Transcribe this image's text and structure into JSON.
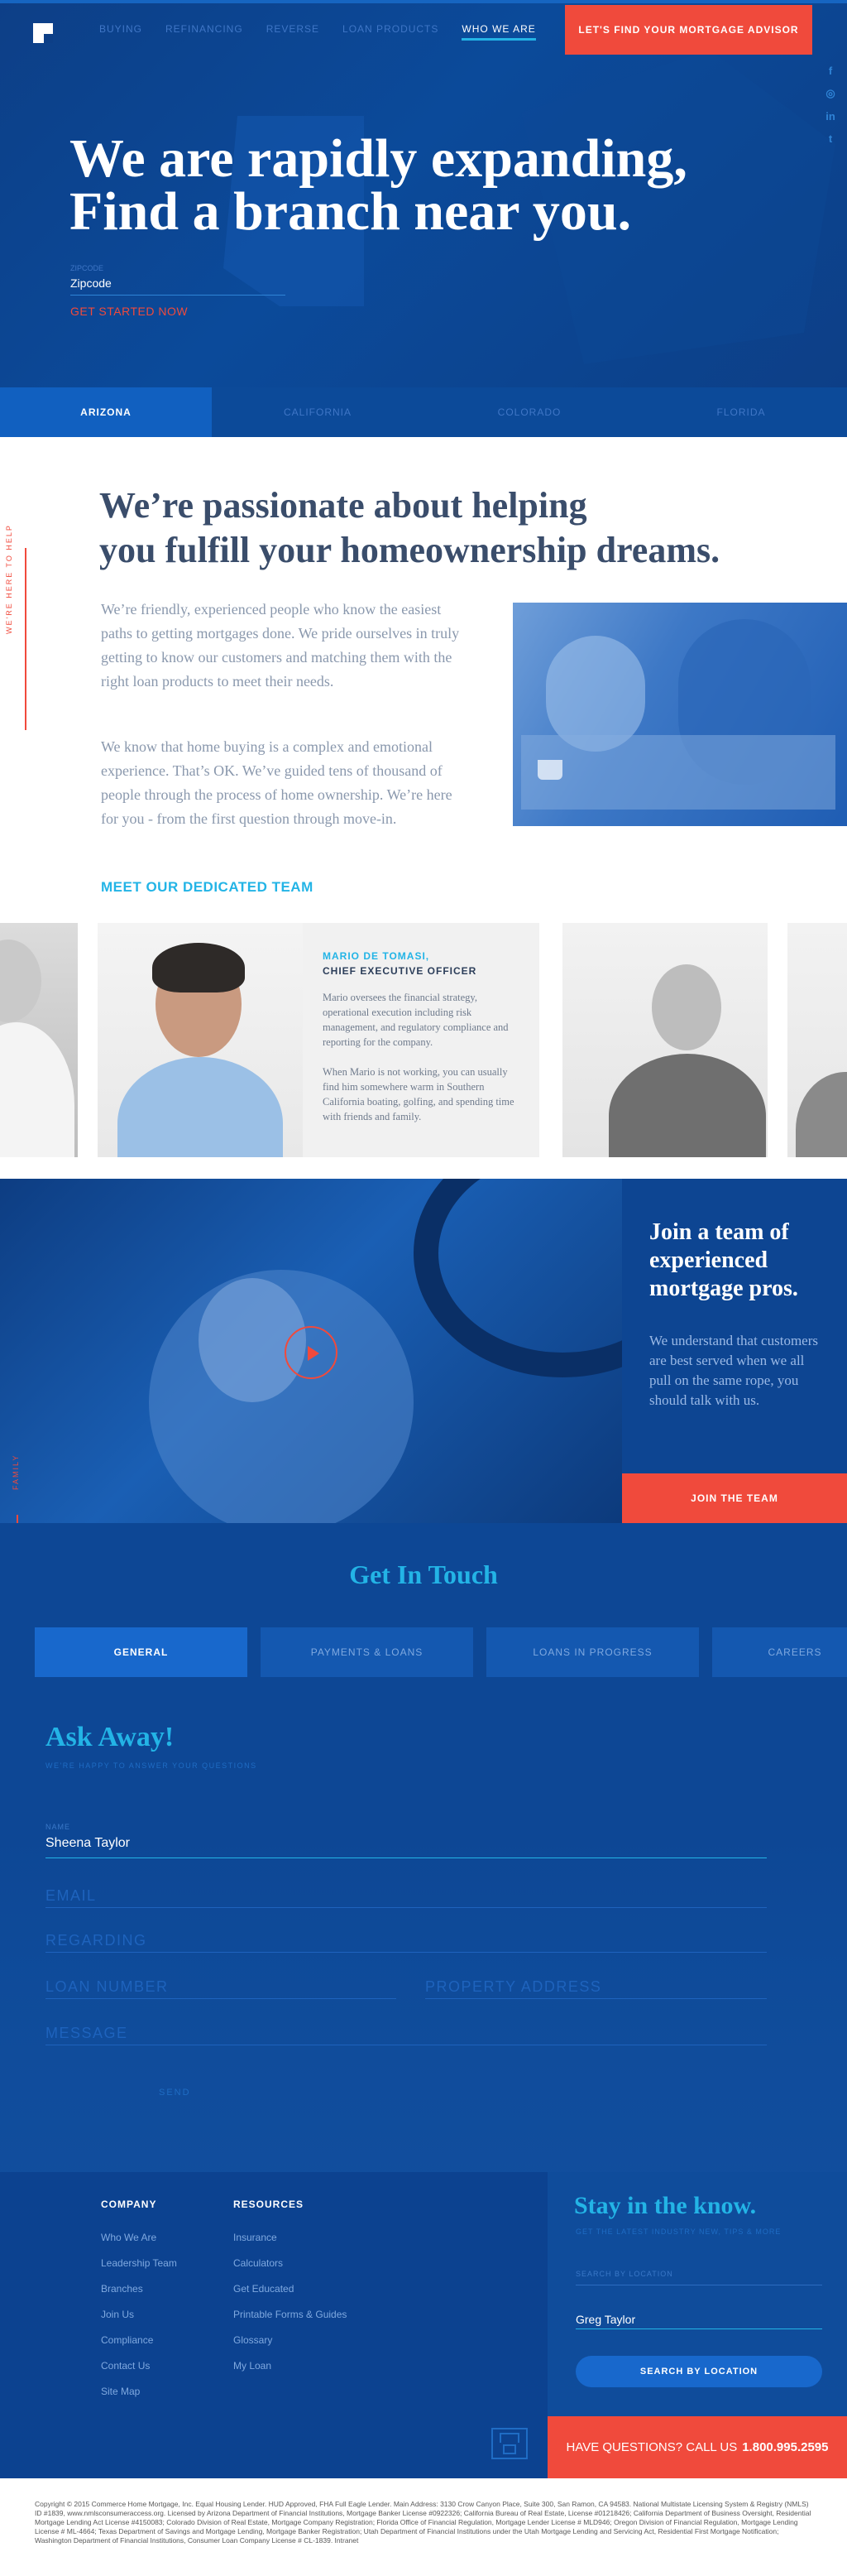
{
  "nav": {
    "items": [
      "BUYING",
      "REFINANCING",
      "REVERSE",
      "LOAN PRODUCTS",
      "WHO WE ARE"
    ],
    "active": "WHO WE ARE",
    "cta": "LET'S FIND YOUR MORTGAGE ADVISOR",
    "social": [
      "f",
      "◎",
      "in",
      "t"
    ]
  },
  "hero": {
    "title_line1": "We are rapidly expanding,",
    "title_line2": "Find a branch near you.",
    "zip_label": "Zipcode",
    "zip_value": "Zipcode",
    "get_started": "GET STARTED NOW"
  },
  "states": [
    "ARIZONA",
    "CALIFORNIA",
    "COLORADO",
    "FLORIDA"
  ],
  "passion": {
    "side_label": "WE'RE HERE TO HELP",
    "title_line1": "We’re  passionate about helping",
    "title_line2": "you fulfill your homeownership dreams.",
    "p1": "We’re friendly, experienced people who know the easiest paths to getting mortgages done. We pride ourselves in truly getting to know our customers and matching them with the right loan products to meet their needs.",
    "p2": "We know that home buying is a complex and emotional experience. That’s OK. We’ve guided tens of thousand of people through the process of home ownership. We’re here for you - from the first question through move-in.",
    "team_link": "MEET OUR DEDICATED TEAM"
  },
  "team": {
    "name": "MARIO DE TOMASI,",
    "role": "CHIEF EXECUTIVE OFFICER",
    "bio1": "Mario oversees the financial strategy, operational execution including risk management, and regulatory compliance and reporting for the company.",
    "bio2": "When Mario is not working, you can usually find him somewhere warm in Southern California boating, golfing, and spending time with friends and family."
  },
  "join": {
    "title": "Join a team of experienced mortgage pros.",
    "text": "We understand that customers are best served when we all pull on the same rope, you should talk with us.",
    "button": "JOIN THE TEAM",
    "side_label": "FAMILY"
  },
  "contact": {
    "title": "Get In Touch",
    "tabs": [
      "GENERAL",
      "PAYMENTS & LOANS",
      "LOANS IN PROGRESS",
      "CAREERS"
    ],
    "ask_title": "Ask Away!",
    "ask_sub": "WE'RE HAPPY TO ANSWER YOUR QUESTIONS",
    "name_label": "NAME",
    "name_value": "Sheena Taylor",
    "email_ph": "EMAIL",
    "regarding_ph": "REGARDING",
    "loan_ph": "LOAN NUMBER",
    "property_ph": "PROPERTY ADDRESS",
    "message_ph": "MESSAGE",
    "send": "SEND"
  },
  "footer": {
    "company_title": "COMPANY",
    "company_links": [
      "Who We Are",
      "Leadership Team",
      "Branches",
      "Join Us",
      "Compliance",
      "Contact Us",
      "Site Map"
    ],
    "resources_title": "RESOURCES",
    "resources_links": [
      "Insurance",
      "Calculators",
      "Get Educated",
      "Printable Forms & Guides",
      "Glossary",
      "My Loan"
    ],
    "stay_title": "Stay in the know.",
    "stay_sub": "GET THE LATEST INDUSTRY NEW, TIPS & MORE",
    "search_label": "SEARCH BY LOCATION",
    "name_value": "Greg Taylor",
    "search_button": "SEARCH BY LOCATION",
    "questions_text": "HAVE QUESTIONS? CALL US",
    "phone": "1.800.995.2595",
    "legal": "Copyright © 2015 Commerce Home Mortgage, Inc. Equal Housing Lender. HUD Approved, FHA Full Eagle Lender. Main Address: 3130 Crow Canyon Place, Suite 300, San Ramon, CA 94583. National Multistate Licensing System & Registry (NMLS) ID #1839, www.nmlsconsumeraccess.org. Licensed by Arizona Department of Financial Institutions, Mortgage Banker License #0922326; California Bureau of Real Estate, License #01218426; California Department of Business Oversight, Residential Mortgage Lending Act License #4150083; Colorado Division of Real Estate, Mortgage Company Registration; Florida Office of Financial Regulation, Mortgage Lender License # MLD946; Oregon Division of Financial Regulation, Mortgage Lending License # ML-4664; Texas Department of Savings and Mortgage Lending, Mortgage Banker Registration; Utah Department of Financial Institutions under the Utah Mortgage Lending and Servicing Act, Residential First Mortgage Notification; Washington Department of Financial Institutions, Consumer Loan Company License # CL-1839. Intranet"
  },
  "colors": {
    "navy": "#0d4795",
    "accent_red": "#f04a3c",
    "accent_cyan": "#23b4e6"
  }
}
